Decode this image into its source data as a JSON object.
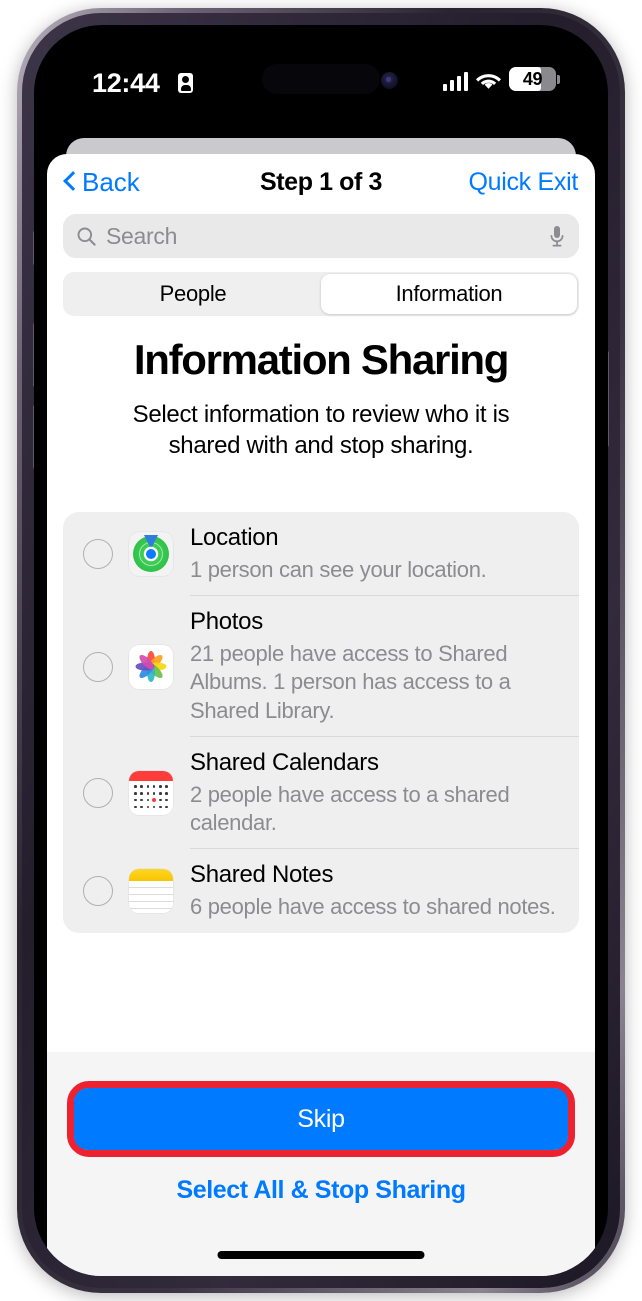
{
  "status_bar": {
    "time": "12:44",
    "privacy_icon": "privacy-id-card-icon",
    "signal_icon": "cellular-signal-icon",
    "wifi_icon": "wifi-icon",
    "battery_percent": "49",
    "battery_level_fraction": 0.49
  },
  "nav": {
    "back_label": "Back",
    "back_icon": "chevron-left-icon",
    "title": "Step 1 of 3",
    "quick_exit_label": "Quick Exit"
  },
  "search": {
    "placeholder": "Search",
    "value": "",
    "search_icon": "search-icon",
    "mic_icon": "microphone-icon"
  },
  "segmented_control": {
    "options": [
      {
        "label": "People",
        "selected": false
      },
      {
        "label": "Information",
        "selected": true
      }
    ]
  },
  "main": {
    "heading": "Information Sharing",
    "subheading": "Select information to review who it is shared with and stop sharing."
  },
  "info_list": [
    {
      "title": "Location",
      "detail": "1 person can see your location.",
      "icon": "find-my-icon",
      "selected": false
    },
    {
      "title": "Photos",
      "detail": "21 people have access to Shared Albums. 1 person has access to a Shared Library.",
      "icon": "photos-icon",
      "selected": false
    },
    {
      "title": "Shared Calendars",
      "detail": "2 people have access to a shared calendar.",
      "icon": "calendar-icon",
      "selected": false
    },
    {
      "title": "Shared Notes",
      "detail": "6 people have access to shared notes.",
      "icon": "notes-icon",
      "selected": false
    }
  ],
  "footer": {
    "primary_button_label": "Skip",
    "primary_button_highlighted": true,
    "secondary_link_label": "Select All & Stop Sharing"
  },
  "colors": {
    "accent_blue": "#007aff",
    "highlight_red": "#ed2231",
    "card_gray": "#efeff0",
    "footer_gray": "#f5f5f6",
    "secondary_text": "#8c8c90"
  }
}
